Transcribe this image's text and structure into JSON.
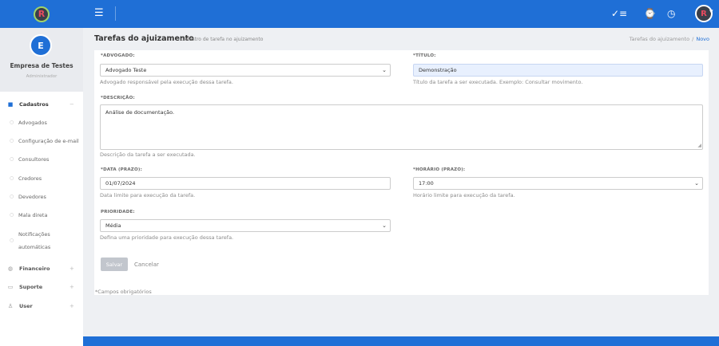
{
  "header": {
    "menu_icon": "hamburger-icon",
    "icons": [
      "checklist-icon",
      "watch-icon",
      "clock-icon"
    ]
  },
  "sidebar": {
    "profile": {
      "initial": "E",
      "name": "Empresa de Testes",
      "role": "Administrador"
    },
    "cadastros": {
      "label": "Cadastros",
      "items": [
        "Advogados",
        "Configuração de e-mail",
        "Consultores",
        "Credores",
        "Devedores",
        "Mala direta",
        "Notificações automáticas"
      ]
    },
    "sections": [
      {
        "label": "Financeiro",
        "icon": "money-icon"
      },
      {
        "label": "Suporte",
        "icon": "support-icon"
      },
      {
        "label": "User",
        "icon": "user-icon"
      }
    ]
  },
  "page": {
    "title": "Tarefas do ajuizamento",
    "subtitle": "cadastro de tarefa no ajuizamento",
    "breadcrumb": {
      "parent": "Tarefas do ajuizamento",
      "current": "Novo"
    }
  },
  "form": {
    "advogado": {
      "label": "*ADVOGADO:",
      "value": "Advogado Teste",
      "help": "Advogado responsável pela execução dessa tarefa."
    },
    "titulo": {
      "label": "*TÍTULO:",
      "value": "Demonstração",
      "help": "Título da tarefa a ser executada. Exemplo: Consultar movimento."
    },
    "descricao": {
      "label": "*DESCRIÇÃO:",
      "value": "Análise de documentação.",
      "help": "Descrição da tarefa a ser executada."
    },
    "data": {
      "label": "*DATA (PRAZO):",
      "value": "01/07/2024",
      "help": "Data limite para execução da tarefa."
    },
    "horario": {
      "label": "*HORÁRIO (PRAZO):",
      "value": "17:00",
      "help": "Horário limite para execução da tarefa."
    },
    "prioridade": {
      "label": "PRIORIDADE:",
      "value": "Média",
      "help": "Defina uma prioridade para execução dessa tarefa."
    },
    "save_label": "Salvar",
    "cancel_label": "Cancelar",
    "required_note": "*Campos obrigatórios"
  },
  "colors": {
    "primary": "#1f6fd6",
    "background": "#eef0f3"
  }
}
